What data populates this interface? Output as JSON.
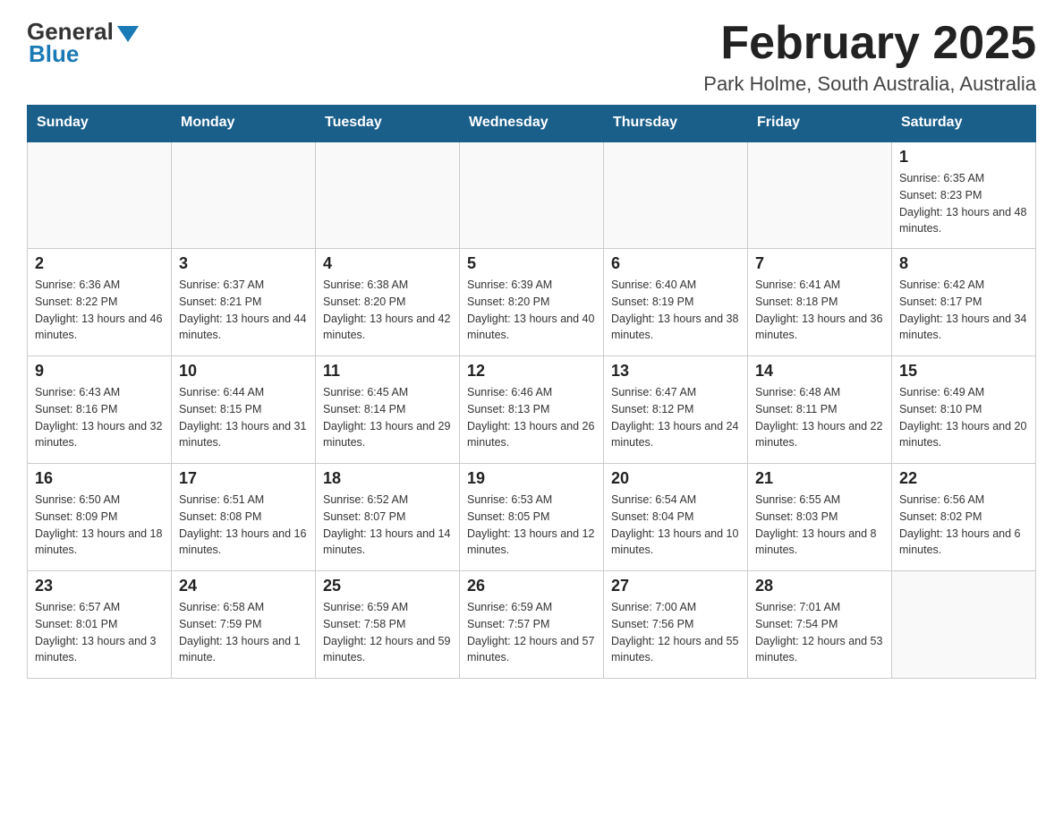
{
  "logo": {
    "general": "General",
    "blue": "Blue"
  },
  "title": "February 2025",
  "subtitle": "Park Holme, South Australia, Australia",
  "weekdays": [
    "Sunday",
    "Monday",
    "Tuesday",
    "Wednesday",
    "Thursday",
    "Friday",
    "Saturday"
  ],
  "weeks": [
    [
      {
        "day": "",
        "info": ""
      },
      {
        "day": "",
        "info": ""
      },
      {
        "day": "",
        "info": ""
      },
      {
        "day": "",
        "info": ""
      },
      {
        "day": "",
        "info": ""
      },
      {
        "day": "",
        "info": ""
      },
      {
        "day": "1",
        "info": "Sunrise: 6:35 AM\nSunset: 8:23 PM\nDaylight: 13 hours and 48 minutes."
      }
    ],
    [
      {
        "day": "2",
        "info": "Sunrise: 6:36 AM\nSunset: 8:22 PM\nDaylight: 13 hours and 46 minutes."
      },
      {
        "day": "3",
        "info": "Sunrise: 6:37 AM\nSunset: 8:21 PM\nDaylight: 13 hours and 44 minutes."
      },
      {
        "day": "4",
        "info": "Sunrise: 6:38 AM\nSunset: 8:20 PM\nDaylight: 13 hours and 42 minutes."
      },
      {
        "day": "5",
        "info": "Sunrise: 6:39 AM\nSunset: 8:20 PM\nDaylight: 13 hours and 40 minutes."
      },
      {
        "day": "6",
        "info": "Sunrise: 6:40 AM\nSunset: 8:19 PM\nDaylight: 13 hours and 38 minutes."
      },
      {
        "day": "7",
        "info": "Sunrise: 6:41 AM\nSunset: 8:18 PM\nDaylight: 13 hours and 36 minutes."
      },
      {
        "day": "8",
        "info": "Sunrise: 6:42 AM\nSunset: 8:17 PM\nDaylight: 13 hours and 34 minutes."
      }
    ],
    [
      {
        "day": "9",
        "info": "Sunrise: 6:43 AM\nSunset: 8:16 PM\nDaylight: 13 hours and 32 minutes."
      },
      {
        "day": "10",
        "info": "Sunrise: 6:44 AM\nSunset: 8:15 PM\nDaylight: 13 hours and 31 minutes."
      },
      {
        "day": "11",
        "info": "Sunrise: 6:45 AM\nSunset: 8:14 PM\nDaylight: 13 hours and 29 minutes."
      },
      {
        "day": "12",
        "info": "Sunrise: 6:46 AM\nSunset: 8:13 PM\nDaylight: 13 hours and 26 minutes."
      },
      {
        "day": "13",
        "info": "Sunrise: 6:47 AM\nSunset: 8:12 PM\nDaylight: 13 hours and 24 minutes."
      },
      {
        "day": "14",
        "info": "Sunrise: 6:48 AM\nSunset: 8:11 PM\nDaylight: 13 hours and 22 minutes."
      },
      {
        "day": "15",
        "info": "Sunrise: 6:49 AM\nSunset: 8:10 PM\nDaylight: 13 hours and 20 minutes."
      }
    ],
    [
      {
        "day": "16",
        "info": "Sunrise: 6:50 AM\nSunset: 8:09 PM\nDaylight: 13 hours and 18 minutes."
      },
      {
        "day": "17",
        "info": "Sunrise: 6:51 AM\nSunset: 8:08 PM\nDaylight: 13 hours and 16 minutes."
      },
      {
        "day": "18",
        "info": "Sunrise: 6:52 AM\nSunset: 8:07 PM\nDaylight: 13 hours and 14 minutes."
      },
      {
        "day": "19",
        "info": "Sunrise: 6:53 AM\nSunset: 8:05 PM\nDaylight: 13 hours and 12 minutes."
      },
      {
        "day": "20",
        "info": "Sunrise: 6:54 AM\nSunset: 8:04 PM\nDaylight: 13 hours and 10 minutes."
      },
      {
        "day": "21",
        "info": "Sunrise: 6:55 AM\nSunset: 8:03 PM\nDaylight: 13 hours and 8 minutes."
      },
      {
        "day": "22",
        "info": "Sunrise: 6:56 AM\nSunset: 8:02 PM\nDaylight: 13 hours and 6 minutes."
      }
    ],
    [
      {
        "day": "23",
        "info": "Sunrise: 6:57 AM\nSunset: 8:01 PM\nDaylight: 13 hours and 3 minutes."
      },
      {
        "day": "24",
        "info": "Sunrise: 6:58 AM\nSunset: 7:59 PM\nDaylight: 13 hours and 1 minute."
      },
      {
        "day": "25",
        "info": "Sunrise: 6:59 AM\nSunset: 7:58 PM\nDaylight: 12 hours and 59 minutes."
      },
      {
        "day": "26",
        "info": "Sunrise: 6:59 AM\nSunset: 7:57 PM\nDaylight: 12 hours and 57 minutes."
      },
      {
        "day": "27",
        "info": "Sunrise: 7:00 AM\nSunset: 7:56 PM\nDaylight: 12 hours and 55 minutes."
      },
      {
        "day": "28",
        "info": "Sunrise: 7:01 AM\nSunset: 7:54 PM\nDaylight: 12 hours and 53 minutes."
      },
      {
        "day": "",
        "info": ""
      }
    ]
  ]
}
